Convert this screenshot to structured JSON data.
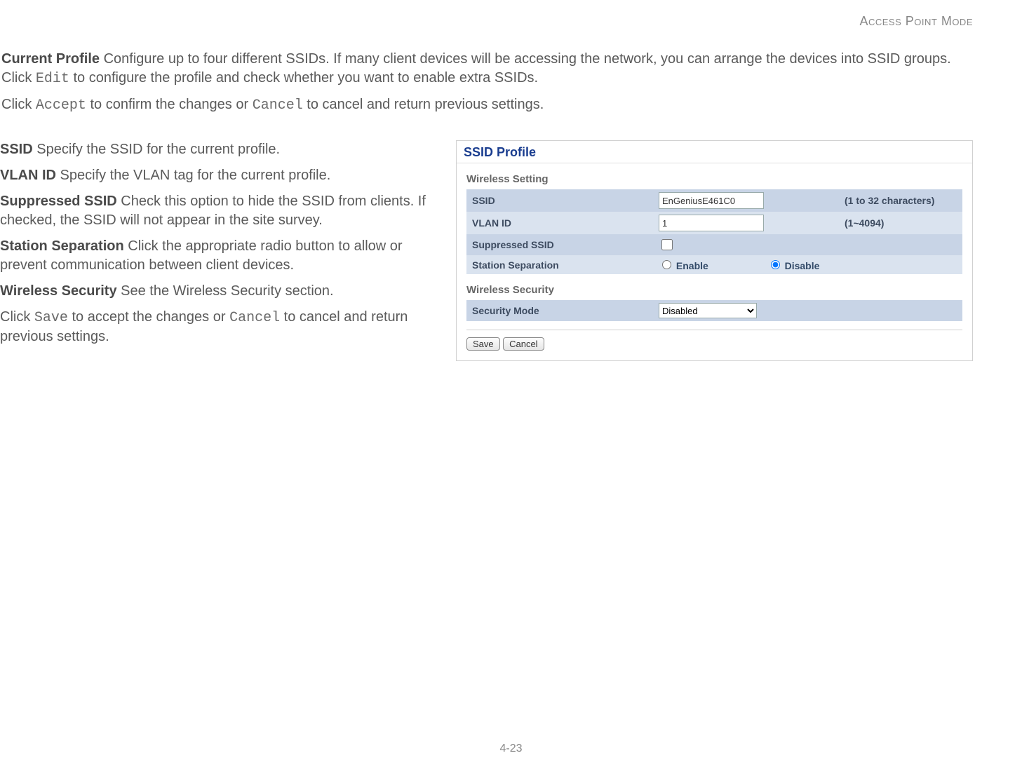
{
  "header": {
    "right": "Access Point Mode"
  },
  "intro": {
    "current_profile_bold": "Current Profile",
    "current_profile_text_a": "  Configure up to four different SSIDs. If many client devices will be accessing the network, you can arrange the devices into SSID groups. Click ",
    "edit_mono": "Edit",
    "current_profile_text_b": " to configure the profile and check whether you want to enable extra SSIDs.",
    "line2_a": "Click ",
    "accept_mono": "Accept",
    "line2_b": " to confirm the changes or ",
    "cancel_mono": "Cancel",
    "line2_c": " to cancel and return previous settings."
  },
  "defs": {
    "ssid_bold": "SSID",
    "ssid_text": "  Specify the SSID for the current profile.",
    "vlan_bold": "VLAN ID",
    "vlan_text": "  Specify the VLAN tag for the current profile.",
    "sup_bold": "Suppressed SSID",
    "sup_text": "  Check this option to hide the SSID from clients. If checked, the SSID will not appear in the site survey.",
    "sep_bold": "Station Separation",
    "sep_text": "  Click the appropriate radio button to allow or prevent communication between client devices.",
    "ws_bold": "Wireless Security",
    "ws_text": "  See the Wireless Security section.",
    "save_a": "Click ",
    "save_mono": "Save",
    "save_b": " to accept the changes or ",
    "save_cancel_mono": "Cancel",
    "save_c": " to cancel and return previous settings."
  },
  "panel": {
    "title": "SSID Profile",
    "section_wireless": "Wireless Setting",
    "row_ssid_label": "SSID",
    "row_ssid_value": "EnGeniusE461C0",
    "row_ssid_hint": "(1 to 32 characters)",
    "row_vlan_label": "VLAN ID",
    "row_vlan_value": "1",
    "row_vlan_hint": "(1~4094)",
    "row_sup_label": "Suppressed SSID",
    "row_sep_label": "Station Separation",
    "row_sep_enable": "Enable",
    "row_sep_disable": "Disable",
    "section_security": "Wireless Security",
    "row_sec_label": "Security Mode",
    "row_sec_value": "Disabled",
    "btn_save": "Save",
    "btn_cancel": "Cancel"
  },
  "page_num": "4-23"
}
